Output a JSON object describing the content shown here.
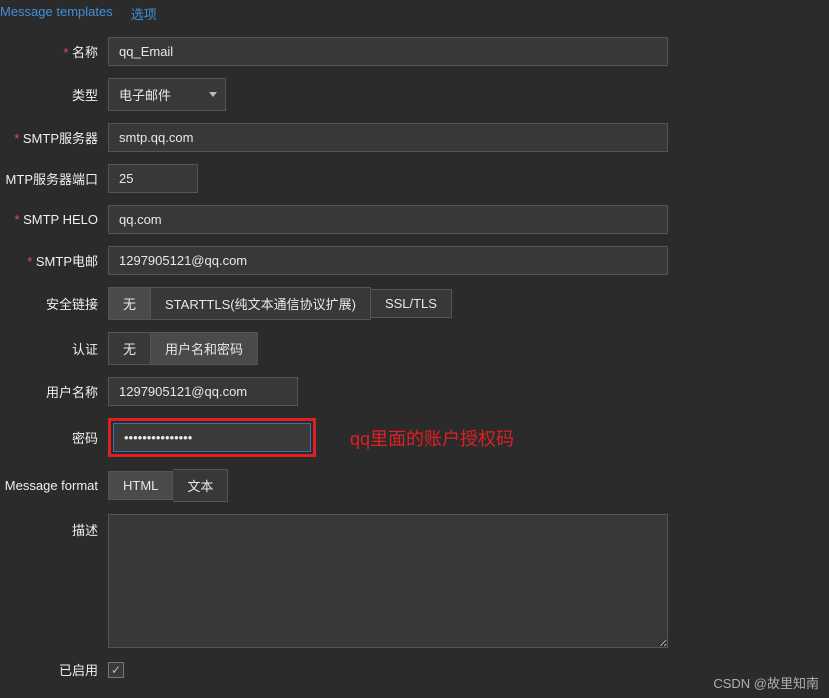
{
  "tabs": {
    "templates": "Message templates",
    "options": "选项"
  },
  "labels": {
    "name": "名称",
    "type": "类型",
    "smtp_server": "SMTP服务器",
    "smtp_port": "MTP服务器端口",
    "smtp_helo": "SMTP HELO",
    "smtp_email": "SMTP电邮",
    "conn_security": "安全链接",
    "auth": "认证",
    "username": "用户名称",
    "password": "密码",
    "message_format": "Message format",
    "description": "描述",
    "enabled": "已启用"
  },
  "values": {
    "name": "qq_Email",
    "type_selected": "电子邮件",
    "smtp_server": "smtp.qq.com",
    "smtp_port": "25",
    "smtp_helo": "qq.com",
    "smtp_email": "1297905121@qq.com",
    "username": "1297905121@qq.com",
    "password": "•••••••••••••••",
    "description": "",
    "enabled": true
  },
  "options": {
    "conn_security": {
      "none": "无",
      "starttls": "STARTTLS(纯文本通信协议扩展)",
      "ssl": "SSL/TLS",
      "active": "none"
    },
    "auth": {
      "none": "无",
      "userpass": "用户名和密码",
      "active": "userpass"
    },
    "message_format": {
      "html": "HTML",
      "text": "文本",
      "active": "html"
    }
  },
  "annotation": "qq里面的账户授权码",
  "watermark": "CSDN @故里知南"
}
